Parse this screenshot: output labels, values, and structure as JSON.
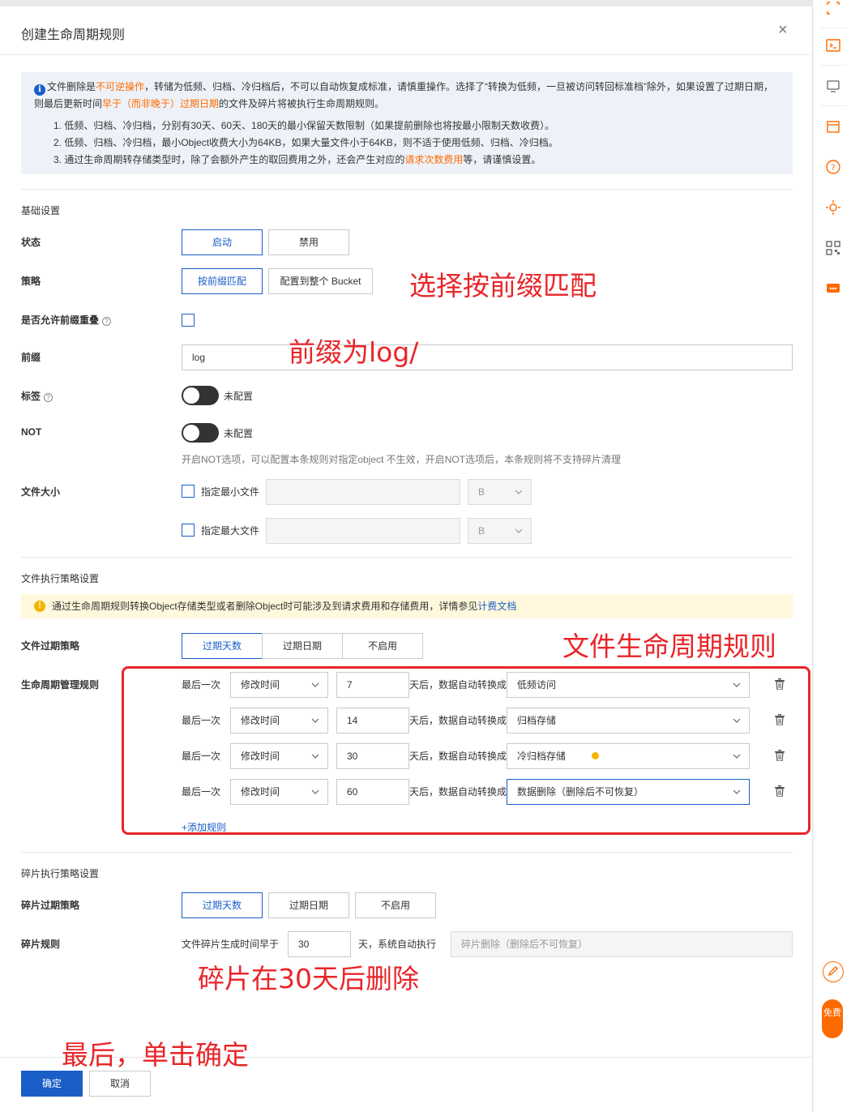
{
  "modal": {
    "title": "创建生命周期规则",
    "close_symbol": "×"
  },
  "notice": {
    "icon": "info-icon",
    "line1": {
      "p1": "文件删除是",
      "hl1": "不可逆操作",
      "p2": "，转储为低频、归档、冷归档后，不可以自动恢复成标准，请慎重操作。选择了“转换为低频，一旦被访问转回标准档”除外，如果设置了过期日期，",
      "p3": "则最后更新时间",
      "hl2": "早于（而非晚于）过期日期",
      "p4": "的文件及碎片将被执行生命周期规则。"
    },
    "items": [
      "1. 低频、归档、冷归档，分别有30天、60天、180天的最小保留天数限制（如果提前删除也将按最小限制天数收费）。",
      "2. 低频、归档、冷归档，最小Object收费大小为64KB，如果大量文件小于64KB，则不适于使用低频、归档、冷归档。"
    ],
    "item3": {
      "p1": "3. 通过生命周期转存储类型时，除了会额外产生的取回费用之外，还会产生对应的",
      "hl": "请求次数费用",
      "p2": "等，请谨慎设置。"
    },
    "highlight_color": "#ff6a00"
  },
  "basic": {
    "section_title": "基础设置",
    "status_label": "状态",
    "status_options": [
      "启动",
      "禁用"
    ],
    "status_selected": "启动",
    "strategy_label": "策略",
    "strategy_options": [
      "按前缀匹配",
      "配置到整个 Bucket"
    ],
    "strategy_selected": "按前缀匹配",
    "prefix_overlap_label": "是否允许前缀重叠",
    "prefix_label": "前缀",
    "prefix_value": "log",
    "tag_label": "标签",
    "tag_state": "未配置",
    "not_label": "NOT",
    "not_state": "未配置",
    "not_hint": "开启NOT选项，可以配置本条规则对指定object 不生效，开启NOT选项后，本条规则将不支持碎片清理",
    "filesize_label": "文件大小",
    "min_file_label": "指定最小文件",
    "max_file_label": "指定最大文件",
    "unit": "B"
  },
  "exec": {
    "section_title": "文件执行策略设置",
    "warning_text": "通过生命周期规则转换Object存储类型或者删除Object时可能涉及到请求费用和存储费用，详情参见",
    "warning_link": "计费文档",
    "expire_label": "文件过期策略",
    "expire_options": [
      "过期天数",
      "过期日期",
      "不启用"
    ],
    "expire_selected": "过期天数",
    "rules_label": "生命周期管理规则",
    "rule_prefix": "最后一次",
    "rule_middle": "天后，数据自动转换成",
    "rules": [
      {
        "time": "修改时间",
        "days": "7",
        "target": "低频访问"
      },
      {
        "time": "修改时间",
        "days": "14",
        "target": "归档存储"
      },
      {
        "time": "修改时间",
        "days": "30",
        "target": "冷归档存储"
      },
      {
        "time": "修改时间",
        "days": "60",
        "target": "数据删除（删除后不可恢复）"
      }
    ],
    "add_rule": "+添加规则"
  },
  "fragment": {
    "section_title": "碎片执行策略设置",
    "expire_label": "碎片过期策略",
    "expire_options": [
      "过期天数",
      "过期日期",
      "不启用"
    ],
    "expire_selected": "过期天数",
    "rule_label": "碎片规则",
    "rule_prefix": "文件碎片生成时间早于",
    "days": "30",
    "rule_suffix": "天，系统自动执行",
    "action": "碎片删除（删除后不可恢复）"
  },
  "footer": {
    "confirm": "确定",
    "cancel": "取消"
  },
  "annotations": {
    "a1": "选择按前缀匹配",
    "a2": "前缀为log/",
    "a3": "文件生命周期规则",
    "a4": "碎片在30天后删除",
    "a5": "最后，单击确定",
    "color": "#e8262a"
  },
  "rail": {
    "free_label": "免费",
    "accent": "#ff6a00"
  },
  "colors": {
    "primary": "#1a5fc8",
    "warning": "#f5b400"
  }
}
